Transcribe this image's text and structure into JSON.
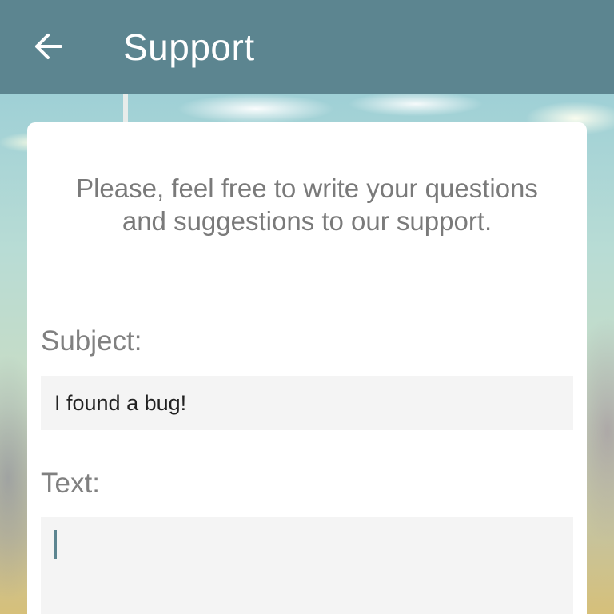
{
  "appbar": {
    "title": "Support",
    "back_icon": "arrow-left-icon",
    "color": "#5c8590"
  },
  "form": {
    "intro": "Please, feel free to write your questions and suggestions to our support.",
    "subject_label": "Subject:",
    "subject_value": "I found a bug!",
    "text_label": "Text:",
    "text_value": ""
  }
}
